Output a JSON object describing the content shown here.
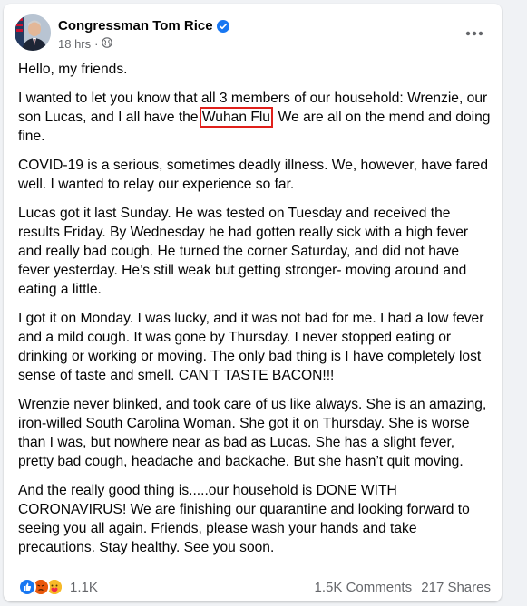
{
  "post": {
    "author": "Congressman Tom Rice",
    "time": "18 hrs",
    "dot": "·",
    "paragraphs": [
      "Hello, my friends.",
      "COVID-19  is a serious, sometimes deadly illness.  We, however, have fared well. I wanted to relay our experience so far.",
      "Lucas got it last Sunday. He was tested on Tuesday and received the results Friday. By Wednesday he had gotten really sick with a high fever and really bad cough. He turned the corner Saturday, and did not have fever yesterday. He’s still weak but getting stronger- moving around and eating a little.",
      "I got it on Monday. I was lucky, and it was not bad for me. I had a low fever and a mild cough. It was gone by Thursday. I never stopped eating or drinking or working or moving. The only bad thing is I have completely lost sense of taste and smell. CAN’T TASTE BACON!!!",
      "Wrenzie never blinked, and took care of us like always. She is an amazing, iron-willed South Carolina Woman. She got it on Thursday. She is worse than I was, but nowhere near as bad as Lucas. She has a slight fever, pretty bad cough, headache and backache.  But she hasn’t quit moving.",
      "And the really good thing is.....our household is DONE WITH CORONAVIRUS! We are finishing our quarantine and looking forward to seeing you all again. Friends, please wash your hands and take precautions. Stay healthy. See you soon."
    ],
    "para2_before": "I wanted to let you know that all 3 members of our household: Wrenzie, our son Lucas, and I all have the ",
    "para2_highlight": "Wuhan Flu",
    "para2_after": ". We are all on the mend and doing fine."
  },
  "footer": {
    "reaction_count": "1.1K",
    "comments": "1.5K Comments",
    "shares": "217 Shares"
  },
  "icons": {
    "verified": "verified-badge-icon",
    "privacy": "globe-icon",
    "more": "more-options-icon"
  },
  "colors": {
    "highlight_box": "#e0201b",
    "like_blue": "#1877f2",
    "verified_blue": "#1877f2"
  }
}
